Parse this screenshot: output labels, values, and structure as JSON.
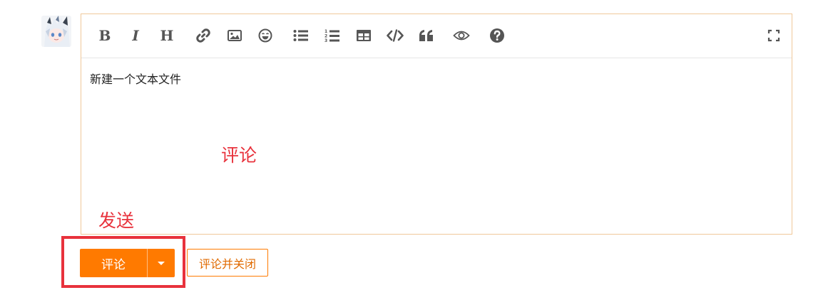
{
  "avatar": {
    "alt": "user avatar"
  },
  "toolbar": {
    "bold_label": "B",
    "italic_label": "I",
    "heading_label": "H",
    "buttons": [
      "bold",
      "italic",
      "heading",
      "link",
      "image",
      "emoji",
      "unordered-list",
      "ordered-list",
      "table",
      "code",
      "quote",
      "preview",
      "help",
      "fullscreen"
    ]
  },
  "editor": {
    "content": "新建一个文本文件"
  },
  "annotations": {
    "comment": "评论",
    "send": "发送"
  },
  "actions": {
    "comment_label": "评论",
    "comment_and_close_label": "评论并关闭"
  },
  "colors": {
    "accent": "#ff7a00",
    "annotation": "#e8323c",
    "editor_border": "#f0c89a"
  }
}
